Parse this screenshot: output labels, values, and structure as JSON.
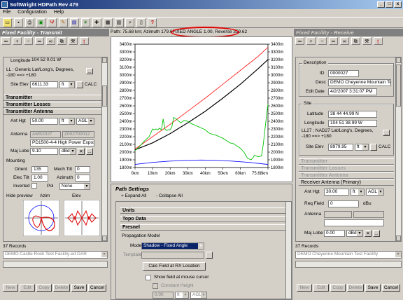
{
  "window": {
    "title": "SoftWright HDPath Rev 479",
    "minimize": "_",
    "maximize": "□",
    "close": "x"
  },
  "menu": [
    "File",
    "Configuration",
    "Help"
  ],
  "toolbar_icons": [
    "open-icon",
    "save-icon",
    "print-icon",
    "map-icon",
    "antenna-icon",
    "edit-icon",
    "graph-icon",
    "find-icon",
    "tools-icon",
    "grid-icon",
    "pin-icon",
    "zoom-icon",
    "page-icon",
    "help-icon"
  ],
  "path_info": {
    "text_before": "Path: 75.68 km; Azimuth 179.6",
    "fixed_angle": "FIXED ANGLE 1.00,",
    "reverse": "Reverse 359.62"
  },
  "left": {
    "header": "Fixed Facility - Transmit",
    "smallbar_icons": [
      "list-icon",
      "add-icon",
      "delete-icon",
      "edit-icon",
      "binoculars-icon",
      "copy-icon",
      "tools-icon",
      "receive-icon"
    ],
    "longitude_label": "Longitude",
    "longitude_value": "104 52 0.01 W",
    "ll_text": "LL : Generic Lat/Long's, Degrees, -180 ==> +180",
    "site_elev_label": "Site Elev",
    "site_elev_value": "6611.33",
    "site_elev_unit": "ft",
    "calc_label": "CALC",
    "sections": [
      "Transmitter",
      "Transmitter Losses",
      "Transmitter Antenna"
    ],
    "ant_hgt_label": "Ant Hgt",
    "ant_hgt_value": "50.00",
    "ant_hgt_unit": "ft",
    "ant_hgt_ref": "AGL",
    "antenna_label": "Antenna",
    "antenna_code1": "AMS2027",
    "antenna_code2": "Z002700012",
    "antenna_desc": "PD1500-4-4 High Power Expos",
    "maj_lobe_label": "Maj Lobe",
    "maj_lobe_value": "9.10",
    "maj_lobe_unit": "dBd",
    "mounting_label": "Mounting",
    "orient_label": "Orient",
    "orient_value": "135",
    "mech_tilt_label": "Mech Tilt",
    "mech_tilt_value": "0",
    "elec_tilt_label": "Elec Tilt",
    "elec_tilt_value": "1.00",
    "azimuth_label": "Azimuth",
    "azimuth_value": "0",
    "inverted_label": "Inverted",
    "pol_label": "Pol",
    "pol_value": "None",
    "hide_preview_label": "Hide preview",
    "azim_label": "Azim",
    "elev_label": "Elev",
    "records_label": "37 Records",
    "records_value": "DEMO Castle Rock Test Facility-ed DAR",
    "buttons": [
      "New",
      "Edit",
      "Copy",
      "Delete",
      "Save",
      "Cancel"
    ]
  },
  "right": {
    "header": "Fixed Facility - Receive",
    "smallbar_icons": [
      "list-icon",
      "add-icon",
      "delete-icon",
      "edit-icon",
      "binoculars-icon",
      "copy-icon",
      "tools-icon",
      "receive-icon"
    ],
    "description_title": "Description",
    "id_label": "ID",
    "id_value": "0000027",
    "desc_label": "Desc",
    "desc_value": "DEMO Cheyenne Mountain Te",
    "edit_date_label": "Edit Date",
    "edit_date_value": "4/2/2007 3:31:07 PM",
    "site_title": "Site",
    "latitude_label": "Latitude",
    "latitude_value": "38 44 44.99 N",
    "longitude_label": "Longitude",
    "longitude_value": "104 51 38.99 W",
    "ll_text": "LL27 : NAD27 Lat/Long's, Degrees, -180 ==> +180",
    "site_elev_label": "Site Elev",
    "site_elev_value": "8979.95",
    "site_elev_unit": "ft",
    "calc_label": "CALC",
    "sections": [
      "Transmitter",
      "Transmitter Losses",
      "Transmitter Antenna",
      "Receiver Antenna (Primary)"
    ],
    "ant_hgt_label": "Ant Hgt",
    "ant_hgt_value": "30.00",
    "ant_hgt_unit": "ft",
    "ant_hgt_ref": "AGL",
    "req_field_label": "Req Field",
    "req_field_value": "0",
    "req_field_unit": "dBu",
    "antenna_label": "Antenna",
    "maj_lobe_label": "Maj Lobe",
    "maj_lobe_value": "0.00",
    "maj_lobe_unit": "dBd",
    "records_label": "37 Records",
    "records_value": "DEMO Cheyenne Mountain Test Facility",
    "buttons": [
      "New",
      "Edit",
      "Copy",
      "Delete",
      "Save",
      "Cancel"
    ]
  },
  "path_settings": {
    "title": "Path Settings",
    "expand_all": "+ Expand All",
    "collapse_all": "- Collapse All",
    "sections": [
      "Units",
      "Topo Data",
      "Fresnel"
    ],
    "propagation_title": "Propagation Model",
    "model_label": "Model",
    "model_value": "Shadow - Fixed Angle",
    "template_label": "Template",
    "calc_btn": "Calc Field at RX Location",
    "show_field_label": "Show field at mouse cursor",
    "constant_height_label": "Constant Height",
    "constant_value": "0.00",
    "constant_unit": "ft",
    "constant_ref": "AGL"
  },
  "chart_data": {
    "type": "line",
    "xlabel": "",
    "ylabel": "",
    "x_ticks": [
      "0km",
      "10km",
      "20km",
      "30km",
      "40km",
      "50km",
      "60km",
      "75.68km"
    ],
    "y_ticks": [
      "3400m",
      "3300m",
      "3200m",
      "3100m",
      "3000m",
      "2900m",
      "2800m",
      "2700m",
      "2600m",
      "2500m",
      "2400m",
      "2300m",
      "2200m",
      "2100m",
      "2000m",
      "1900m",
      "1800m"
    ],
    "xlim": [
      0,
      75.68
    ],
    "ylim": [
      1800,
      3400
    ],
    "colors": {
      "terrain": "#00c000",
      "los": "#000000",
      "earth": "#1010ff",
      "fresnel": "#ff2020"
    },
    "series": [
      {
        "key": "earth",
        "x": [
          0,
          10,
          20,
          30,
          37.8,
          45,
          55,
          65,
          75.68
        ],
        "y": [
          1840,
          1866,
          1884,
          1894,
          1897,
          1894,
          1884,
          1866,
          1840
        ]
      },
      {
        "key": "los",
        "x": [
          0,
          10,
          20,
          30,
          40,
          50,
          60,
          70,
          75.68
        ],
        "y": [
          2030,
          2120,
          2240,
          2380,
          2530,
          2700,
          2880,
          3080,
          3200
        ]
      },
      {
        "key": "fresnel",
        "x": [
          0,
          10,
          20,
          30,
          40,
          50,
          60,
          70,
          75.68
        ],
        "y": [
          2040,
          2200,
          2360,
          2530,
          2700,
          2880,
          3060,
          3240,
          3360
        ]
      },
      {
        "key": "terrain",
        "x": [
          0,
          2,
          4,
          6,
          8,
          10,
          11,
          12,
          13,
          14,
          15,
          16,
          17,
          18,
          19,
          20,
          21,
          22,
          24,
          26,
          28,
          30,
          32,
          34,
          36,
          38,
          40,
          42,
          44,
          46,
          48,
          50,
          52,
          54,
          56,
          58,
          60,
          62,
          63,
          64,
          65,
          66,
          67,
          68,
          70,
          72,
          73,
          74,
          75,
          75.68
        ],
        "y": [
          2020,
          2060,
          2110,
          2160,
          2200,
          2300,
          2290,
          2300,
          2290,
          2310,
          2290,
          2430,
          2300,
          2280,
          2290,
          2290,
          2330,
          2450,
          2420,
          2380,
          2410,
          2400,
          2370,
          2350,
          2330,
          2310,
          2290,
          2250,
          2230,
          2220,
          2200,
          2180,
          2150,
          2120,
          2110,
          2080,
          2050,
          2000,
          1960,
          1920,
          1910,
          1900,
          1920,
          1960,
          1940,
          1950,
          2100,
          2300,
          2500,
          2620
        ]
      }
    ]
  }
}
